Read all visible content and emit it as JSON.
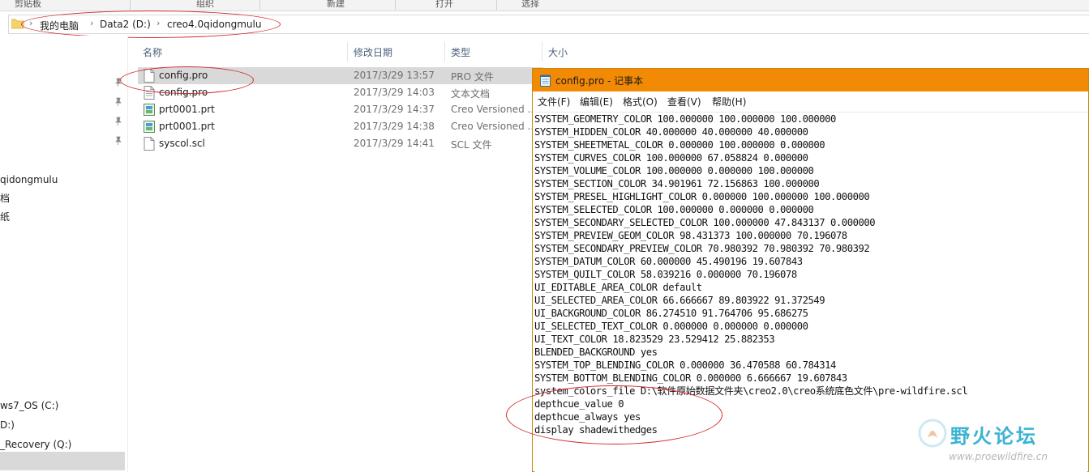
{
  "ribbon": {
    "clipboard": "剪贴板",
    "new": "新建",
    "organize": "组织",
    "open": "打开",
    "select": "选择"
  },
  "breadcrumb": {
    "items": [
      "我的电脑",
      "Data2 (D:)",
      "creo4.0qidongmulu"
    ]
  },
  "nav": {
    "items": [
      "qidongmulu",
      "档",
      "纸",
      "",
      "ws7_OS (C:)",
      "D:)",
      "_Recovery (Q:)"
    ]
  },
  "filelist": {
    "columns": {
      "name": "名称",
      "date": "修改日期",
      "type": "类型",
      "size": "大小"
    },
    "rows": [
      {
        "name": "config.pro",
        "date": "2017/3/29 13:57",
        "type": "PRO 文件",
        "icon": "document-icon"
      },
      {
        "name": "config.pro",
        "date": "2017/3/29 14:03",
        "type": "文本文档",
        "icon": "text-file-icon"
      },
      {
        "name": "prt0001.prt",
        "date": "2017/3/29 14:37",
        "type": "Creo Versioned ...",
        "icon": "creo-part-icon"
      },
      {
        "name": "prt0001.prt",
        "date": "2017/3/29 14:38",
        "type": "Creo Versioned ...",
        "icon": "creo-part-icon"
      },
      {
        "name": "syscol.scl",
        "date": "2017/3/29 14:41",
        "type": "SCL 文件",
        "icon": "document-icon"
      }
    ]
  },
  "notepad": {
    "title": "config.pro - 记事本",
    "menu": [
      "文件(F)",
      "编辑(E)",
      "格式(O)",
      "查看(V)",
      "帮助(H)"
    ],
    "lines": [
      "SYSTEM_GEOMETRY_COLOR 100.000000 100.000000 100.000000",
      "SYSTEM_HIDDEN_COLOR 40.000000 40.000000 40.000000",
      "SYSTEM_SHEETMETAL_COLOR 0.000000 100.000000 0.000000",
      "SYSTEM_CURVES_COLOR 100.000000 67.058824 0.000000",
      "SYSTEM_VOLUME_COLOR 100.000000 0.000000 100.000000",
      "SYSTEM_SECTION_COLOR 34.901961 72.156863 100.000000",
      "SYSTEM_PRESEL_HIGHLIGHT_COLOR 0.000000 100.000000 100.000000",
      "SYSTEM_SELECTED_COLOR 100.000000 0.000000 0.000000",
      "SYSTEM_SECONDARY_SELECTED_COLOR 100.000000 47.843137 0.000000",
      "SYSTEM_PREVIEW_GEOM_COLOR 98.431373 100.000000 70.196078",
      "SYSTEM_SECONDARY_PREVIEW_COLOR 70.980392 70.980392 70.980392",
      "SYSTEM_DATUM_COLOR 60.000000 45.490196 19.607843",
      "SYSTEM_QUILT_COLOR 58.039216 0.000000 70.196078",
      "UI_EDITABLE_AREA_COLOR default",
      "UI_SELECTED_AREA_COLOR 66.666667 89.803922 91.372549",
      "UI_BACKGROUND_COLOR 86.274510 91.764706 95.686275",
      "UI_SELECTED_TEXT_COLOR 0.000000 0.000000 0.000000",
      "UI_TEXT_COLOR 18.823529 23.529412 25.882353",
      "BLENDED_BACKGROUND yes",
      "SYSTEM_TOP_BLENDING_COLOR 0.000000 36.470588 60.784314",
      "SYSTEM_BOTTOM_BLENDING_COLOR 0.000000 6.666667 19.607843",
      "system_colors_file D:\\软件原始数据文件夹\\creo2.0\\creo系统底色文件\\pre-wildfire.scl",
      "depthcue_value 0",
      "depthcue_always yes",
      "display shadewithedges"
    ]
  },
  "watermark": {
    "text": "野火论坛",
    "url": "www.proewildfire.cn"
  },
  "colors": {
    "notepad_title": "#f38a06",
    "annotation": "#d22a2a",
    "watermark": "#3bb3d3"
  }
}
